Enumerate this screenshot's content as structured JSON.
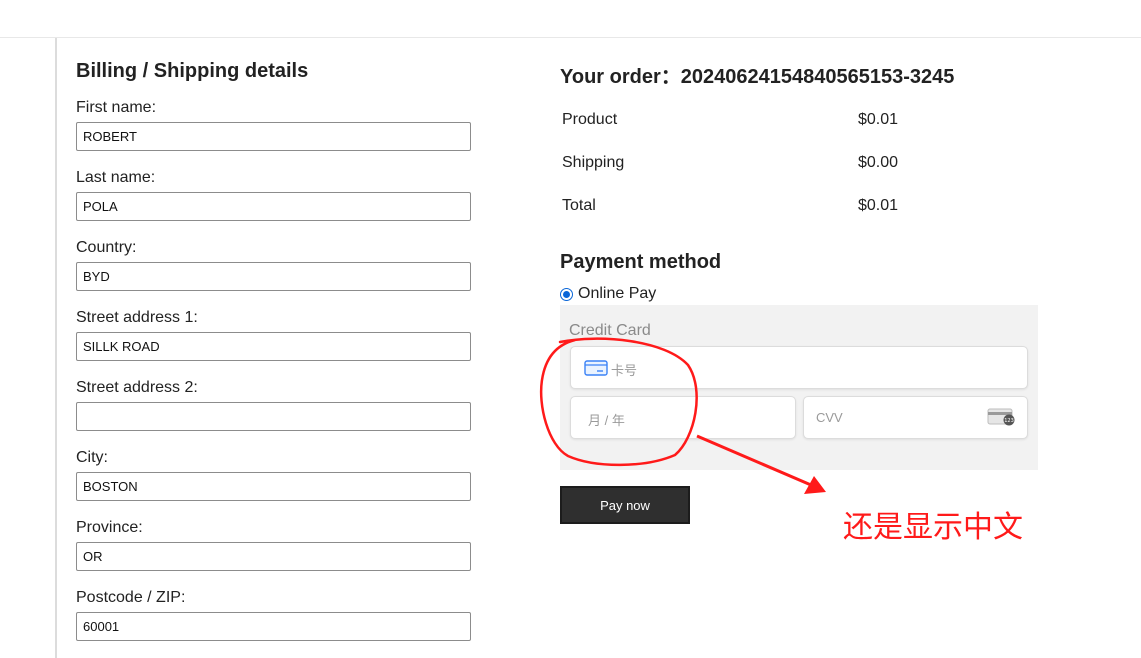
{
  "billing": {
    "title": "Billing / Shipping details",
    "fields": [
      {
        "label": "First name:",
        "value": "ROBERT"
      },
      {
        "label": "Last name:",
        "value": "POLA"
      },
      {
        "label": "Country:",
        "value": "BYD"
      },
      {
        "label": "Street address 1:",
        "value": "SILLK ROAD"
      },
      {
        "label": "Street address 2:",
        "value": ""
      },
      {
        "label": "City:",
        "value": "BOSTON"
      },
      {
        "label": "Province:",
        "value": "OR"
      },
      {
        "label": "Postcode / ZIP:",
        "value": "60001"
      }
    ]
  },
  "order": {
    "title": "Your order：20240624154840565153-3245",
    "rows": [
      {
        "label": "Product",
        "value": "$0.01"
      },
      {
        "label": "Shipping",
        "value": "$0.00"
      },
      {
        "label": "Total",
        "value": "$0.01"
      }
    ]
  },
  "payment": {
    "title": "Payment method",
    "option_label": "Online Pay",
    "credit_card_title": "Credit Card",
    "card_number_placeholder": "卡号",
    "expiry_placeholder": "月 / 年",
    "cvv_placeholder": "CVV",
    "cvv_icon_text": "123",
    "pay_button": "Pay now"
  },
  "annotation": {
    "note": "还是显示中文",
    "color": "#ff1a1a"
  },
  "colors": {
    "radio_accent": "#0a66d8",
    "button_bg": "#2f2f2f",
    "card_panel_bg": "#f2f2f2"
  }
}
